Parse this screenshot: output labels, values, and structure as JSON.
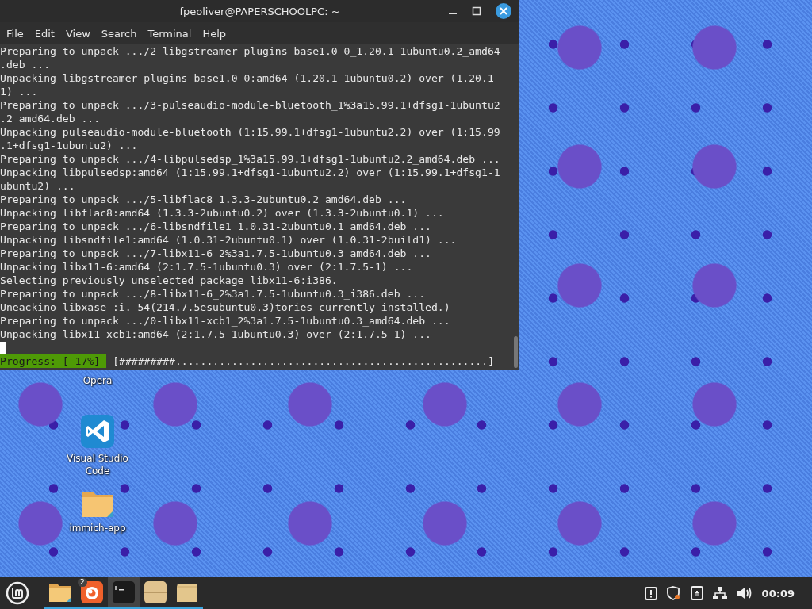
{
  "desktop_icons": [
    {
      "kind": "label",
      "label": "Opera"
    },
    {
      "kind": "vscode",
      "label": "Visual Studio Code"
    },
    {
      "kind": "folder",
      "label": "immich-app"
    }
  ],
  "window": {
    "title": "fpeoliver@PAPERSCHOOLPC: ~",
    "menu": [
      "File",
      "Edit",
      "View",
      "Search",
      "Terminal",
      "Help"
    ],
    "lines": [
      "Preparing to unpack .../2-libgstreamer-plugins-base1.0-0_1.20.1-1ubuntu0.2_amd64",
      ".deb ...",
      "Unpacking libgstreamer-plugins-base1.0-0:amd64 (1.20.1-1ubuntu0.2) over (1.20.1-",
      "1) ...",
      "Preparing to unpack .../3-pulseaudio-module-bluetooth_1%3a15.99.1+dfsg1-1ubuntu2",
      ".2_amd64.deb ...",
      "Unpacking pulseaudio-module-bluetooth (1:15.99.1+dfsg1-1ubuntu2.2) over (1:15.99",
      ".1+dfsg1-1ubuntu2) ...",
      "Preparing to unpack .../4-libpulsedsp_1%3a15.99.1+dfsg1-1ubuntu2.2_amd64.deb ...",
      "Unpacking libpulsedsp:amd64 (1:15.99.1+dfsg1-1ubuntu2.2) over (1:15.99.1+dfsg1-1",
      "ubuntu2) ...",
      "Preparing to unpack .../5-libflac8_1.3.3-2ubuntu0.2_amd64.deb ...",
      "Unpacking libflac8:amd64 (1.3.3-2ubuntu0.2) over (1.3.3-2ubuntu0.1) ...",
      "Preparing to unpack .../6-libsndfile1_1.0.31-2ubuntu0.1_amd64.deb ...",
      "Unpacking libsndfile1:amd64 (1.0.31-2ubuntu0.1) over (1.0.31-2build1) ...",
      "Preparing to unpack .../7-libx11-6_2%3a1.7.5-1ubuntu0.3_amd64.deb ...",
      "Unpacking libx11-6:amd64 (2:1.7.5-1ubuntu0.3) over (2:1.7.5-1) ...",
      "Selecting previously unselected package libx11-6:i386.",
      "Preparing to unpack .../8-libx11-6_2%3a1.7.5-1ubuntu0.3_i386.deb ...",
      "Uneackino libxase :i. 54(214.7.5esubuntu0.3)tories currently installed.)",
      "Preparing to unpack .../0-libx11-xcb1_2%3a1.7.5-1ubuntu0.3_amd64.deb ...",
      "Unpacking libx11-xcb1:amd64 (2:1.7.5-1ubuntu0.3) over (2:1.7.5-1) ..."
    ],
    "progress_label": "Progress: [ 17%]",
    "progress_bar": "[#########..................................................]"
  },
  "taskbar": {
    "apps": [
      {
        "kind": "folder",
        "selected": false
      },
      {
        "kind": "firefox",
        "badge": "2",
        "selected": false
      },
      {
        "kind": "terminal",
        "selected": true
      },
      {
        "kind": "box",
        "selected": false
      },
      {
        "kind": "box2",
        "selected": false
      }
    ],
    "clock": "00:09"
  }
}
